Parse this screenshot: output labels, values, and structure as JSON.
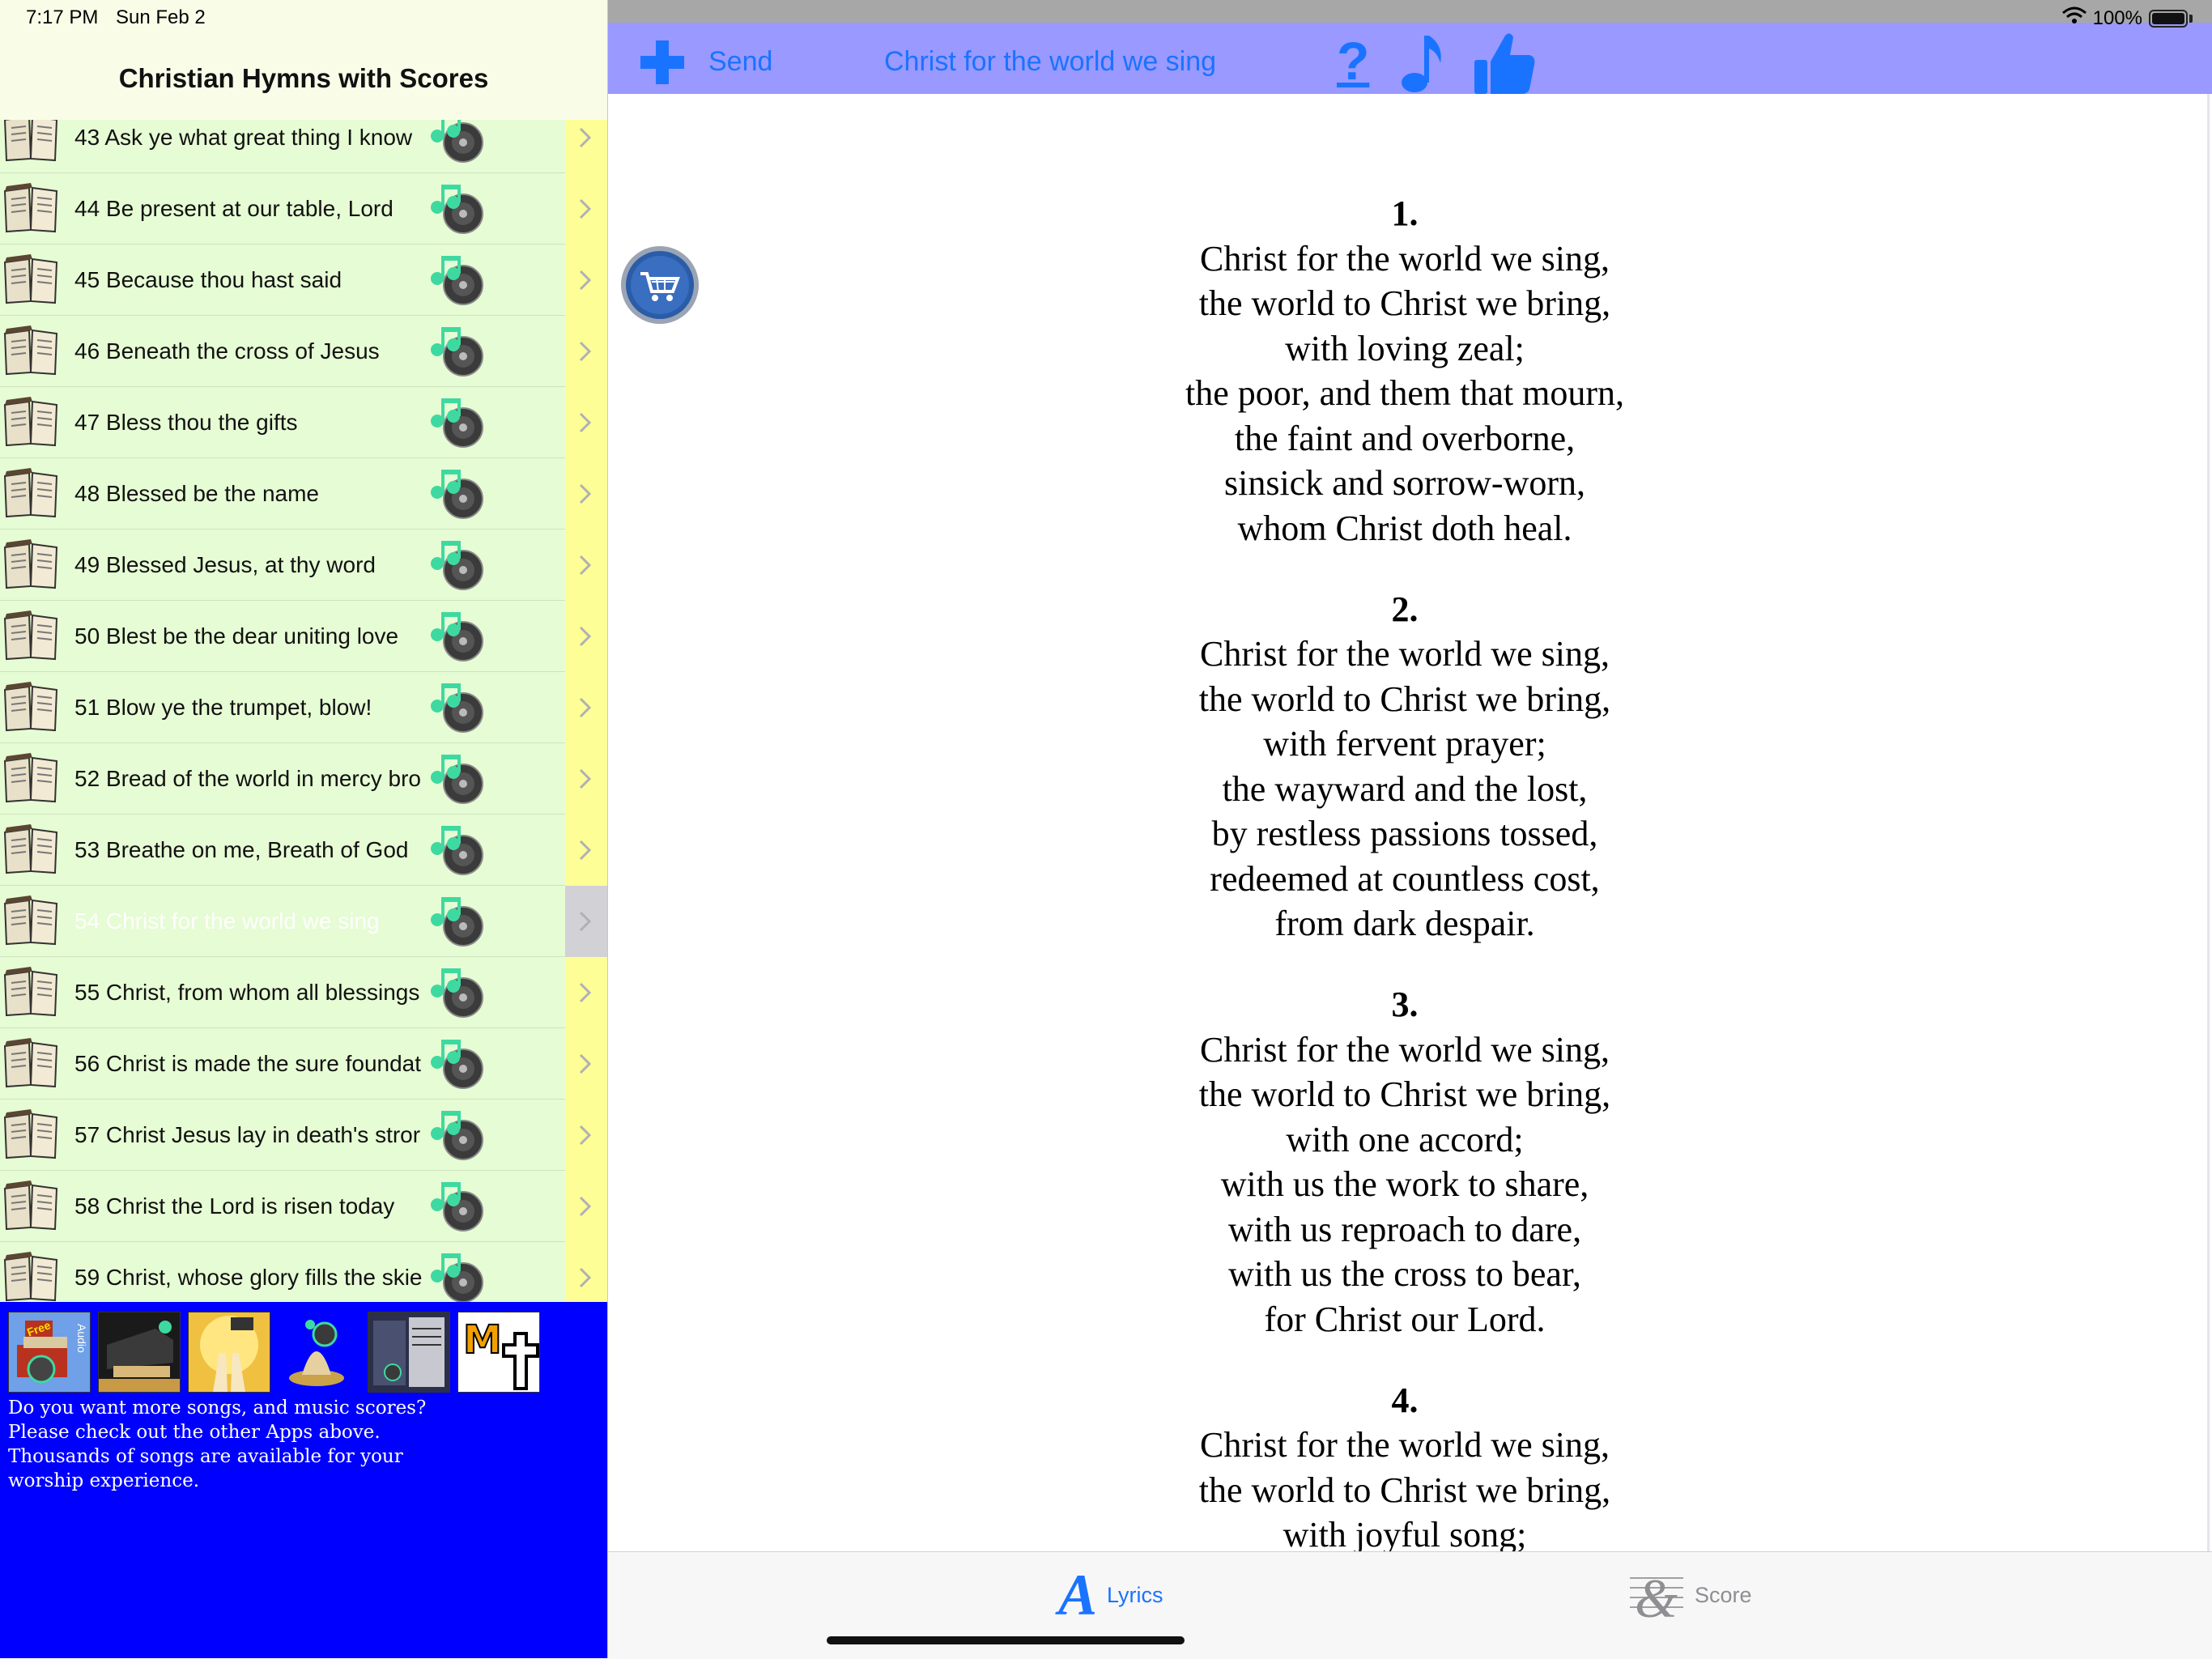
{
  "status_bar": {
    "time": "7:17 PM",
    "date": "Sun Feb 2",
    "battery": "100%"
  },
  "left_panel": {
    "title": "Christian Hymns with Scores",
    "hymns": [
      {
        "label": "43 Ask ye what great thing I know"
      },
      {
        "label": "44 Be present at our table, Lord"
      },
      {
        "label": "45 Because thou hast said"
      },
      {
        "label": "46 Beneath the cross of Jesus"
      },
      {
        "label": "47 Bless thou the gifts"
      },
      {
        "label": "48 Blessed be the name"
      },
      {
        "label": "49 Blessed Jesus, at thy word"
      },
      {
        "label": "50 Blest be the dear uniting love"
      },
      {
        "label": "51 Blow ye the trumpet, blow!"
      },
      {
        "label": "52 Bread of the world in mercy bro"
      },
      {
        "label": "53 Breathe on me, Breath of God"
      },
      {
        "label": "54 Christ for the world we sing",
        "selected": true
      },
      {
        "label": "55 Christ, from whom all blessings"
      },
      {
        "label": "56 Christ is made the sure foundat"
      },
      {
        "label": "57 Christ Jesus lay in death's stror"
      },
      {
        "label": "58 Christ the Lord is risen today"
      },
      {
        "label": "59 Christ, whose glory fills the skie"
      }
    ],
    "promo": {
      "icons": [
        "free-audio-app-icon",
        "piano-app-icon",
        "worship-hands-app-icon",
        "audio-hymns-app-icon",
        "hymnal-books-app-icon",
        "m-cross-app-icon"
      ],
      "free_badge": "Free",
      "audio_badge": "Audio",
      "lines": [
        "Do you want more songs, and music scores?",
        "Please check out the other Apps above.",
        "Thousands of songs are available for your",
        "worship experience."
      ]
    }
  },
  "right_panel": {
    "nav": {
      "send": "Send",
      "title": "Christ for the world we sing",
      "help": "?"
    },
    "verses": [
      {
        "number": "1.",
        "lines": [
          "Christ for the world we sing,",
          "the world to Christ we bring,",
          "with loving zeal;",
          "the poor, and them that mourn,",
          "the faint and overborne,",
          "sinsick and sorrow-worn,",
          "whom Christ doth heal."
        ]
      },
      {
        "number": "2.",
        "lines": [
          "Christ for the world we sing,",
          "the world to Christ we bring,",
          "with fervent prayer;",
          "the wayward and the lost,",
          "by restless passions tossed,",
          "redeemed at countless cost,",
          "from dark despair."
        ]
      },
      {
        "number": "3.",
        "lines": [
          "Christ for the world we sing,",
          "the world to Christ we bring,",
          "with one accord;",
          "with us the work to share,",
          "with us reproach to dare,",
          "with us the cross to bear,",
          "for Christ our Lord."
        ]
      },
      {
        "number": "4.",
        "lines": [
          "Christ for the world we sing,",
          "the world to Christ we bring,",
          "with joyful song;"
        ]
      }
    ],
    "tabs": {
      "lyrics": "Lyrics",
      "score": "Score"
    }
  },
  "colors": {
    "list_row": "#e6fcd4",
    "chevron_column": "#fefe96",
    "nav_bar": "#9999ff",
    "accent_blue": "#1a73ff",
    "promo_bg": "#0000fe",
    "audio_icon_green": "#3ed9a0"
  }
}
